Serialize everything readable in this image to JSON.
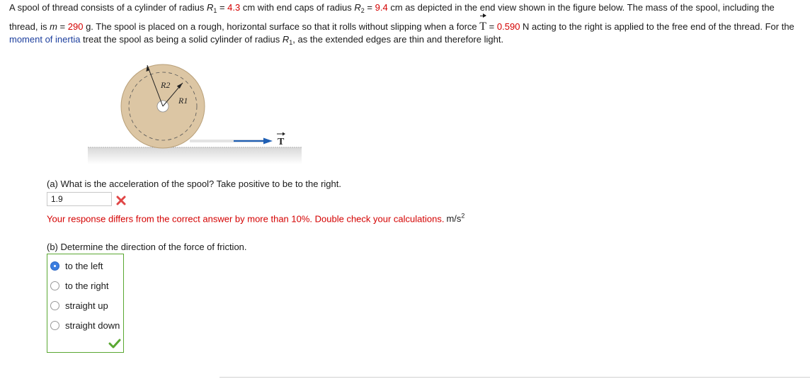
{
  "problem": {
    "line1_a": "A spool of thread consists of a cylinder of radius ",
    "r1_sym": "R",
    "r1_sub": "1",
    "eq1": " = ",
    "r1_val": "4.3",
    "line1_b": " cm with end caps of radius ",
    "r2_sym": "R",
    "r2_sub": "2",
    "eq2": " = ",
    "r2_val": "9.4",
    "line1_c": " cm as depicted in the end view shown in the figure below. The mass of the spool, including the",
    "line2_a": "thread, is ",
    "m_sym": "m",
    "eq3": " = ",
    "m_val": "290",
    "line2_b": " g. The spool is placed on a rough, horizontal surface so that it rolls without slipping when a force ",
    "t_sym": "T",
    "eq4": " = ",
    "t_val": "0.590",
    "line2_c": " N acting to the right is applied to the free end of the thread. For the",
    "link_text": "moment of inertia",
    "line3_a": " treat the spool as being a solid cylinder of radius ",
    "r1b_sym": "R",
    "r1b_sub": "1",
    "line3_b": ", as the extended edges are thin and therefore light."
  },
  "figure": {
    "label_r2": "R2",
    "label_r1": "R1",
    "label_t": "T"
  },
  "part_a": {
    "question": "(a) What is the acceleration of the spool? Take positive to be to the right.",
    "answer_value": "1.9",
    "status": "incorrect",
    "feedback": "Your response differs from the correct answer by more than 10%. Double check your calculations.",
    "unit_base": "m/s",
    "unit_exp": "2"
  },
  "part_b": {
    "question": "(b) Determine the direction of the force of friction.",
    "options": [
      {
        "label": "to the left",
        "selected": true
      },
      {
        "label": "to the right",
        "selected": false
      },
      {
        "label": "straight up",
        "selected": false
      },
      {
        "label": "straight down",
        "selected": false
      }
    ],
    "status": "correct"
  },
  "colors": {
    "given_value": "#d40000",
    "link": "#1d3f9e",
    "spool_fill": "#dcc6a4",
    "force_arrow": "#1f5fb4",
    "correct_border": "#5aa832",
    "radio_selected": "#3b7ee0"
  },
  "icons": {
    "wrong": "x-mark-icon",
    "correct": "checkmark-icon"
  }
}
